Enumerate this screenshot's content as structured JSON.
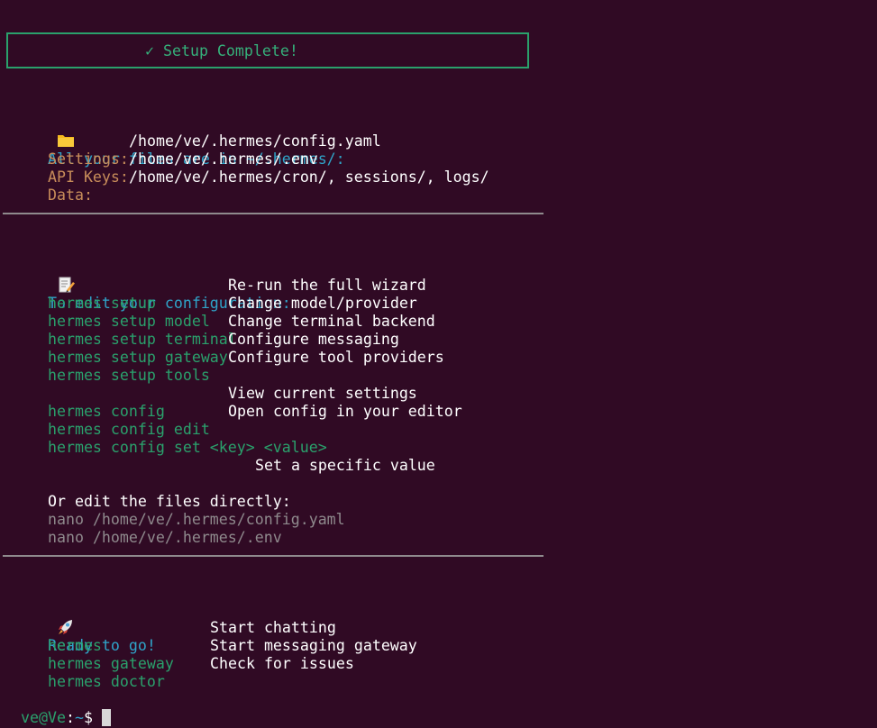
{
  "banner": {
    "text": "✓ Setup Complete!"
  },
  "files_section": {
    "heading": "All your files are in ~/.hermes/:",
    "rows": [
      {
        "label": "Settings:",
        "value": "/home/ve/.hermes/config.yaml"
      },
      {
        "label": "API Keys:",
        "value": "/home/ve/.hermes/.env"
      },
      {
        "label": "Data:",
        "value": "/home/ve/.hermes/cron/, sessions/, logs/"
      }
    ]
  },
  "edit_section": {
    "heading": "To edit your configuration:",
    "setup_commands": [
      {
        "cmd": "hermes setup",
        "desc": "Re-run the full wizard"
      },
      {
        "cmd": "hermes setup model",
        "desc": "Change model/provider"
      },
      {
        "cmd": "hermes setup terminal",
        "desc": "Change terminal backend"
      },
      {
        "cmd": "hermes setup gateway",
        "desc": "Configure messaging"
      },
      {
        "cmd": "hermes setup tools",
        "desc": "Configure tool providers"
      }
    ],
    "config_commands": [
      {
        "cmd": "hermes config",
        "desc": "View current settings"
      },
      {
        "cmd": "hermes config edit",
        "desc": "Open config in your editor"
      }
    ],
    "config_set": {
      "cmd": "hermes config set <key> <value>",
      "desc": "Set a specific value"
    },
    "direct_heading": "Or edit the files directly:",
    "direct_commands": [
      "nano /home/ve/.hermes/config.yaml",
      "nano /home/ve/.hermes/.env"
    ]
  },
  "ready_section": {
    "heading": "Ready to go!",
    "commands": [
      {
        "cmd": "hermes",
        "desc": "Start chatting"
      },
      {
        "cmd": "hermes gateway",
        "desc": "Start messaging gateway"
      },
      {
        "cmd": "hermes doctor",
        "desc": "Check for issues"
      }
    ]
  },
  "prompt": {
    "user_host": "ve@Ve",
    "separator": ":",
    "path": "~",
    "symbol": "$"
  },
  "icons": {
    "files": "folder-icon",
    "edit": "memo-icon",
    "ready": "rocket-icon"
  },
  "colors": {
    "background": "#300a24",
    "command": "#2aa16c",
    "heading": "#2fa4c9",
    "label": "#c88d5a",
    "dim": "#8f8a8d"
  }
}
